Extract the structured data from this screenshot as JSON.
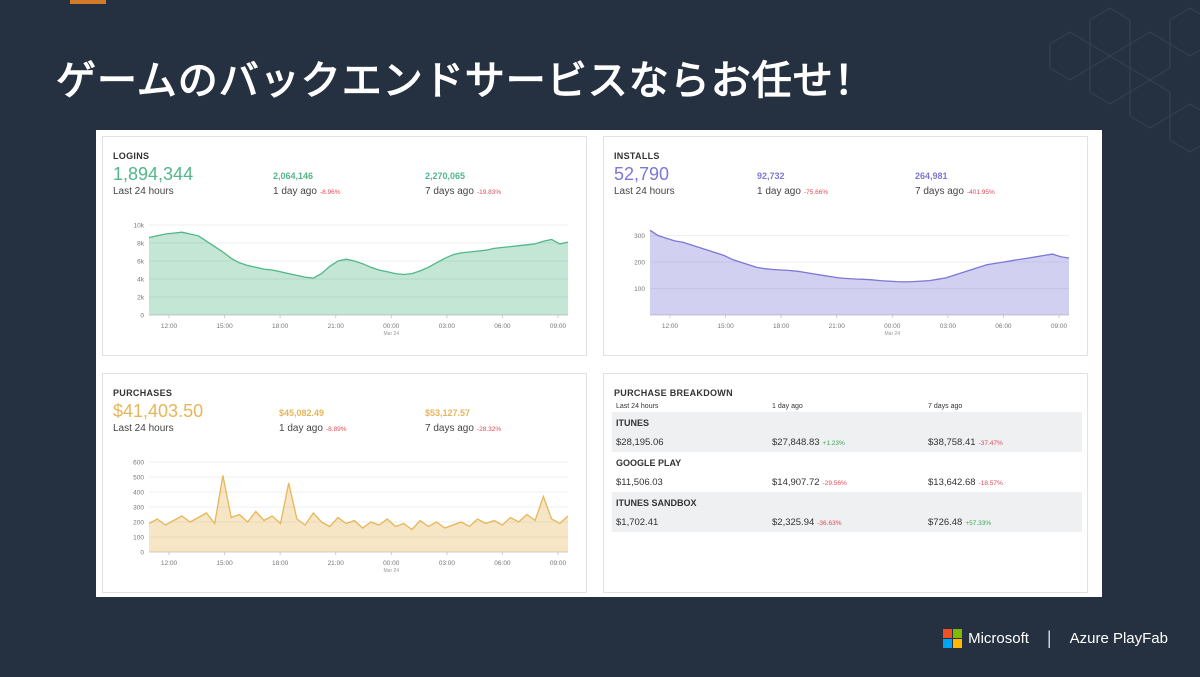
{
  "slide": {
    "title": "ゲームのバックエンドサービスならお任せ！",
    "footer": {
      "company": "Microsoft",
      "product": "Azure PlayFab"
    }
  },
  "colors": {
    "logins": "#52b788",
    "installs": "#7b78d6",
    "purchases": "#e7b659",
    "down": "#e04a5a",
    "up": "#3aa65a",
    "ms_red": "#f25022",
    "ms_green": "#7fba00",
    "ms_blue": "#00a4ef",
    "ms_yellow": "#ffb900"
  },
  "logins": {
    "title": "LOGINS",
    "value": "1,894,344",
    "label": "Last 24 hours",
    "day": {
      "value": "2,064,146",
      "label": "1 day ago",
      "pct": "-8.96%"
    },
    "week": {
      "value": "2,270,065",
      "label": "7 days ago",
      "pct": "-19.83%"
    }
  },
  "installs": {
    "title": "INSTALLS",
    "value": "52,790",
    "label": "Last 24 hours",
    "day": {
      "value": "92,732",
      "label": "1 day ago",
      "pct": "-75.66%"
    },
    "week": {
      "value": "264,981",
      "label": "7 days ago",
      "pct": "-401.95%"
    }
  },
  "purchases": {
    "title": "PURCHASES",
    "value": "$41,403.50",
    "label": "Last 24 hours",
    "day": {
      "value": "$45,082.49",
      "label": "1 day ago",
      "pct": "-8.89%"
    },
    "week": {
      "value": "$53,127.57",
      "label": "7 days ago",
      "pct": "-28.32%"
    }
  },
  "breakdown": {
    "title": "PURCHASE BREAKDOWN",
    "headers": [
      "Last 24 hours",
      "1 day ago",
      "7 days ago"
    ],
    "rows": [
      {
        "name": "ITUNES",
        "last": "$28,195.06",
        "day": "$27,848.83",
        "day_pct": "+1.23%",
        "week": "$38,758.41",
        "week_pct": "-37.47%"
      },
      {
        "name": "GOOGLE PLAY",
        "last": "$11,506.03",
        "day": "$14,907.72",
        "day_pct": "-29.56%",
        "week": "$13,642.68",
        "week_pct": "-18.57%"
      },
      {
        "name": "ITUNES SANDBOX",
        "last": "$1,702.41",
        "day": "$2,325.94",
        "day_pct": "-36.63%",
        "week": "$726.48",
        "week_pct": "+57.33%"
      }
    ]
  },
  "chart_data": [
    {
      "type": "area",
      "name": "logins",
      "x_ticks": [
        "12:00",
        "15:00",
        "18:00",
        "21:00",
        "00:00",
        "03:00",
        "06:00",
        "09:00"
      ],
      "x_sublabel": "Mar 24",
      "y_ticks": [
        "0",
        "2k",
        "4k",
        "6k",
        "8k",
        "10k"
      ],
      "ylim": [
        0,
        10000
      ],
      "y": [
        8600,
        8800,
        9000,
        9100,
        9200,
        9000,
        8800,
        8200,
        7600,
        7000,
        6300,
        5800,
        5500,
        5300,
        5100,
        5000,
        4800,
        4600,
        4400,
        4200,
        4100,
        4600,
        5400,
        6000,
        6200,
        6000,
        5700,
        5300,
        5000,
        4800,
        4600,
        4500,
        4600,
        4900,
        5300,
        5800,
        6300,
        6700,
        6900,
        7000,
        7100,
        7200,
        7400,
        7500,
        7600,
        7700,
        7800,
        7900,
        8200,
        8400,
        7900,
        8100
      ]
    },
    {
      "type": "area",
      "name": "installs",
      "x_ticks": [
        "12:00",
        "15:00",
        "18:00",
        "21:00",
        "00:00",
        "03:00",
        "06:00",
        "09:00"
      ],
      "x_sublabel": "Mar 24",
      "y_ticks": [
        "100",
        "200",
        "300"
      ],
      "ylim": [
        0,
        340
      ],
      "y": [
        320,
        300,
        290,
        280,
        275,
        265,
        255,
        245,
        235,
        225,
        210,
        200,
        190,
        180,
        175,
        172,
        170,
        168,
        165,
        160,
        155,
        150,
        145,
        140,
        138,
        136,
        135,
        133,
        130,
        128,
        126,
        125,
        126,
        128,
        130,
        135,
        140,
        150,
        160,
        170,
        180,
        190,
        195,
        200,
        205,
        210,
        215,
        220,
        225,
        230,
        220,
        215
      ]
    },
    {
      "type": "area",
      "name": "purchases",
      "x_ticks": [
        "12:00",
        "15:00",
        "18:00",
        "21:00",
        "00:00",
        "03:00",
        "06:00",
        "09:00"
      ],
      "x_sublabel": "Mar 24",
      "y_ticks": [
        "0",
        "100",
        "200",
        "300",
        "400",
        "500",
        "600"
      ],
      "ylim": [
        0,
        600
      ],
      "y": [
        190,
        220,
        180,
        210,
        240,
        200,
        230,
        260,
        190,
        510,
        230,
        250,
        200,
        270,
        210,
        240,
        190,
        460,
        220,
        180,
        260,
        200,
        170,
        230,
        190,
        210,
        160,
        200,
        180,
        220,
        170,
        190,
        150,
        210,
        170,
        200,
        160,
        180,
        200,
        170,
        220,
        190,
        210,
        180,
        230,
        200,
        250,
        210,
        370,
        220,
        190,
        240
      ]
    }
  ]
}
